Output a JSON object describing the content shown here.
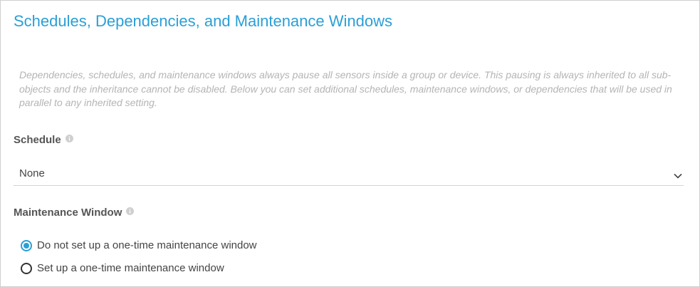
{
  "section": {
    "title": "Schedules, Dependencies, and Maintenance Windows",
    "note": "Dependencies, schedules, and maintenance windows always pause all sensors inside a group or device. This pausing is always inherited to all sub-objects and the inheritance cannot be disabled. Below you can set additional schedules, maintenance windows, or dependencies that will be used in parallel to any inherited setting."
  },
  "schedule": {
    "label": "Schedule",
    "info_icon": "info-icon",
    "selected": "None",
    "dropdown_icon": "chevron-down-icon"
  },
  "maintenance": {
    "label": "Maintenance Window",
    "info_icon": "info-icon",
    "options": [
      {
        "label": "Do not set up a one-time maintenance window",
        "checked": true
      },
      {
        "label": "Set up a one-time maintenance window",
        "checked": false
      }
    ]
  },
  "colors": {
    "accent": "#2a9fd6",
    "note_text": "#b4b4b4",
    "label_text": "#555555"
  }
}
